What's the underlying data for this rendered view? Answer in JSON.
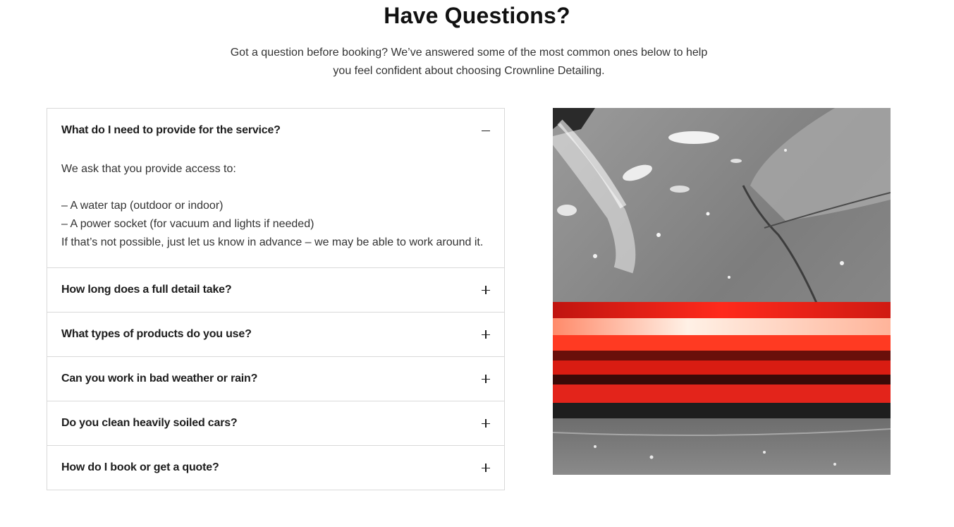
{
  "section": {
    "title": "Have Questions?",
    "intro_line1": "Got a question before booking? We’ve answered some of the most common ones below to help",
    "intro_line2": "you feel confident about choosing Crownline Detailing."
  },
  "faq": {
    "items": [
      {
        "question": "What do I need to provide for the service?",
        "expanded": true,
        "icon": "minus-icon",
        "answer": {
          "intro": "We ask that you provide access to:",
          "line1": "– A water tap (outdoor or indoor)",
          "line2": "– A power socket (for vacuum and lights if needed)",
          "line3": "If that’s not possible, just let us know in advance – we may be able to work around it."
        }
      },
      {
        "question": "How long does a full detail take?",
        "expanded": false,
        "icon": "plus-icon"
      },
      {
        "question": "What types of products do you use?",
        "expanded": false,
        "icon": "plus-icon"
      },
      {
        "question": "Can you work in bad weather or rain?",
        "expanded": false,
        "icon": "plus-icon"
      },
      {
        "question": "Do you clean heavily soiled cars?",
        "expanded": false,
        "icon": "plus-icon"
      },
      {
        "question": "How do I book or get a quote?",
        "expanded": false,
        "icon": "plus-icon"
      }
    ]
  },
  "image": {
    "subject": "car-taillight-water-splash-photo",
    "colors": {
      "body": "#8a8a8a",
      "light": "#e3241b",
      "glow": "#ffd9c7"
    }
  }
}
